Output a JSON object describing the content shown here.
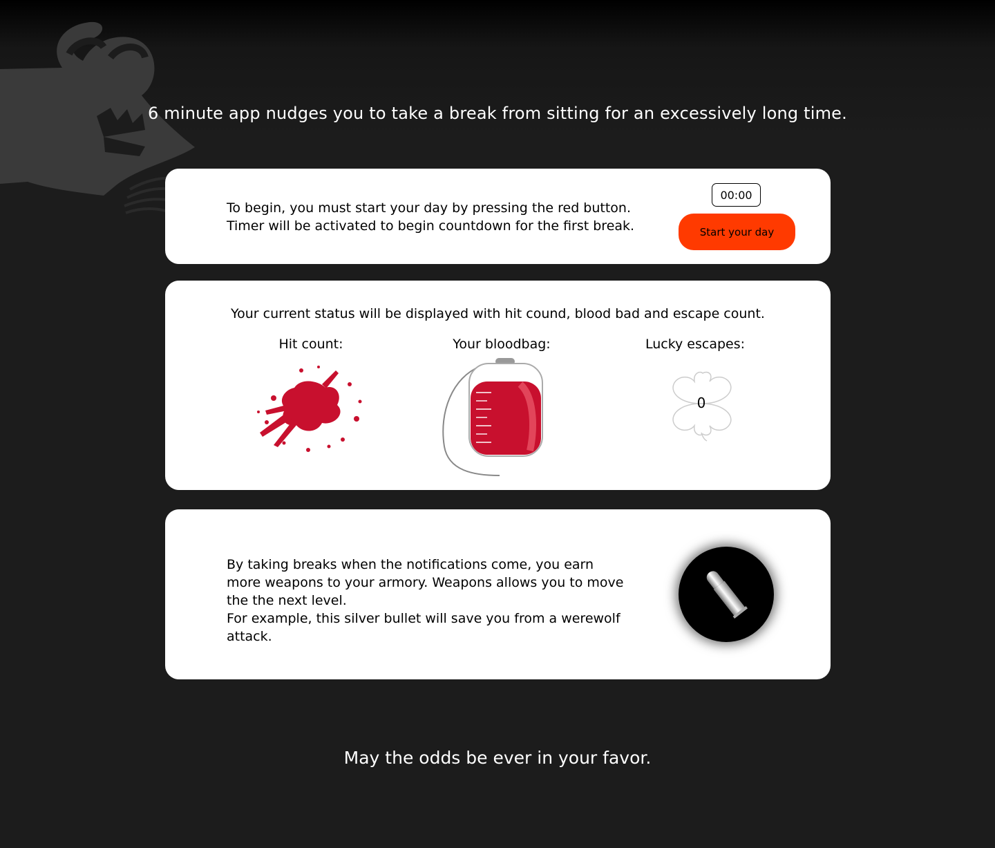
{
  "header": {
    "tagline": "6 minute app nudges you to take a break from sitting for an excessively long time."
  },
  "start_card": {
    "line1": "To begin, you must start your day by pressing the red button.",
    "line2": "Timer will be activated to begin countdown for the first break.",
    "timer_value": "00:00",
    "start_button_label": "Start your day"
  },
  "status_card": {
    "intro": "Your current status will be displayed with hit cound, blood bad and escape count.",
    "hit_label": "Hit count:",
    "blood_label": "Your bloodbag:",
    "lucky_label": "Lucky escapes:",
    "lucky_count": "0"
  },
  "weapons_card": {
    "line1": "By taking breaks when the notifications come, you earn more weapons to your armory. Weapons allows you to move the the next level.",
    "line2": "For example, this silver bullet will save you from a werewolf attack."
  },
  "footer": {
    "text": "May the odds be ever in your favor."
  },
  "colors": {
    "accent": "#ff3a00",
    "blood": "#c8102e",
    "background": "#1c1c1c"
  },
  "icons": [
    "werewolf-icon",
    "blood-splatter-icon",
    "bloodbag-icon",
    "clover-icon",
    "silver-bullet-icon"
  ]
}
